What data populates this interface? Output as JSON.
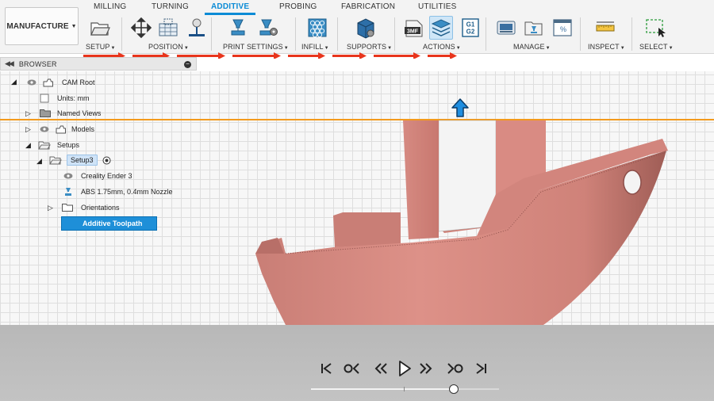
{
  "workspace": {
    "label": "MANUFACTURE"
  },
  "tabs": [
    {
      "label": "MILLING",
      "active": false
    },
    {
      "label": "TURNING",
      "active": false
    },
    {
      "label": "ADDITIVE",
      "active": true
    },
    {
      "label": "PROBING",
      "active": false
    },
    {
      "label": "FABRICATION",
      "active": false
    },
    {
      "label": "UTILITIES",
      "active": false
    }
  ],
  "groups": {
    "setup": "SETUP",
    "position": "POSITION",
    "print_settings": "PRINT SETTINGS",
    "infill": "INFILL",
    "supports": "SUPPORTS",
    "actions": "ACTIONS",
    "manage": "MANAGE",
    "inspect": "INSPECT",
    "select": "SELECT"
  },
  "tool_icons": {
    "setup": "folder-open-icon",
    "move": "move-arrows-icon",
    "arrange": "arrange-grid-icon",
    "place": "place-on-platform-icon",
    "print_setting": "print-setting-icon",
    "print_setting_edit": "print-setting-edit-icon",
    "infill": "infill-hexagon-icon",
    "supports": "support-block-icon",
    "export_3mf_badge": "3MF",
    "simulate": "simulate-layers-icon",
    "gcode_badge": [
      "G1",
      "G2"
    ],
    "library": "machine-library-icon",
    "template": "template-library-icon",
    "task_manager": "task-manager-icon",
    "measure": "ruler-icon",
    "select": "selection-box-icon"
  },
  "browser": {
    "title": "BROWSER",
    "tree": {
      "cam_root": "CAM Root",
      "units": "Units: mm",
      "named_views": "Named Views",
      "models": "Models",
      "setups": "Setups",
      "setup3": "Setup3",
      "machine": "Creality Ender 3",
      "print_setting": "ABS 1.75mm, 0.4mm Nozzle",
      "orientations": "Orientations",
      "toolpath": "Additive Toolpath"
    }
  },
  "colors": {
    "accent": "#0b8bd6",
    "selection": "#1e8fd8",
    "annotation_arrow": "#e8351c",
    "build_plane": "#f39a1c",
    "model": "#d98a82"
  },
  "playback": {
    "buttons": [
      "skip-to-start-icon",
      "previous-operation-icon",
      "step-back-icon",
      "play-icon",
      "step-forward-icon",
      "next-operation-icon",
      "skip-to-end-icon"
    ],
    "progress": 0.76
  }
}
